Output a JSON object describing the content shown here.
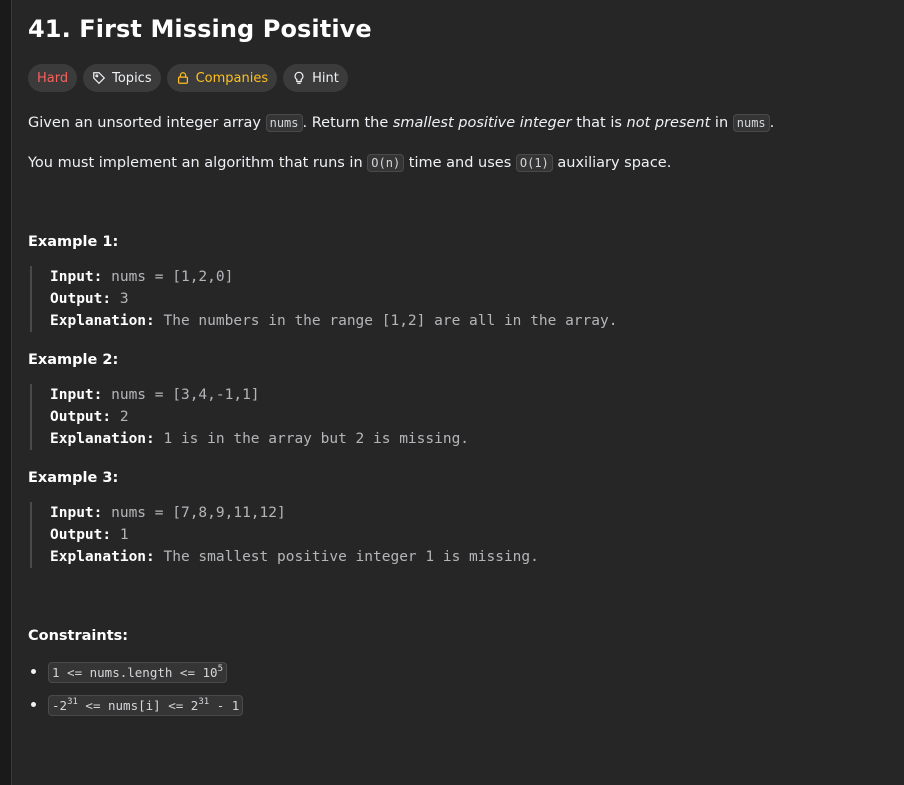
{
  "title": "41. First Missing Positive",
  "tags": {
    "difficulty": "Hard",
    "topics": "Topics",
    "companies": "Companies",
    "hint": "Hint"
  },
  "colors": {
    "hard": "#f8615c",
    "companies": "#ffc01e",
    "background": "#262626"
  },
  "description": {
    "p1_a": "Given an unsorted integer array ",
    "p1_code1": "nums",
    "p1_b": ". Return the ",
    "p1_em1": "smallest positive integer",
    "p1_c": " that is ",
    "p1_em2": "not present",
    "p1_d": " in ",
    "p1_code2": "nums",
    "p1_e": ".",
    "p2_a": "You must implement an algorithm that runs in ",
    "p2_code1": "O(n)",
    "p2_b": " time and uses ",
    "p2_code2": "O(1)",
    "p2_c": " auxiliary space."
  },
  "examples": [
    {
      "title": "Example 1:",
      "input_label": "Input:",
      "input": " nums = [1,2,0]",
      "output_label": "Output:",
      "output": " 3",
      "explanation_label": "Explanation:",
      "explanation": " The numbers in the range [1,2] are all in the array."
    },
    {
      "title": "Example 2:",
      "input_label": "Input:",
      "input": " nums = [3,4,-1,1]",
      "output_label": "Output:",
      "output": " 2",
      "explanation_label": "Explanation:",
      "explanation": " 1 is in the array but 2 is missing."
    },
    {
      "title": "Example 3:",
      "input_label": "Input:",
      "input": " nums = [7,8,9,11,12]",
      "output_label": "Output:",
      "output": " 1",
      "explanation_label": "Explanation:",
      "explanation": " The smallest positive integer 1 is missing."
    }
  ],
  "constraints": {
    "title": "Constraints:",
    "c1_a": "1 <= nums.length <= 10",
    "c1_sup": "5",
    "c2_a": "-2",
    "c2_sup1": "31",
    "c2_b": " <= nums[i] <= 2",
    "c2_sup2": "31",
    "c2_c": " - 1"
  },
  "icons": [
    "tag-icon",
    "lock-icon",
    "lightbulb-icon"
  ]
}
